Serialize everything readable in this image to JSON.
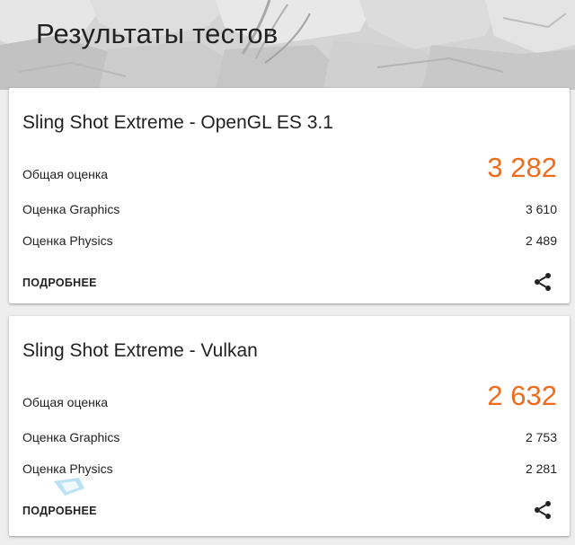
{
  "header": {
    "title": "Результаты тестов"
  },
  "cards": [
    {
      "title": "Sling Shot Extreme - OpenGL ES 3.1",
      "overall_label": "Общая оценка",
      "overall_value": "3 282",
      "graphics_label": "Оценка Graphics",
      "graphics_value": "3 610",
      "physics_label": "Оценка Physics",
      "physics_value": "2 489",
      "more_label": "ПОДРОБНЕЕ",
      "share_icon": "share-icon"
    },
    {
      "title": "Sling Shot Extreme - Vulkan",
      "overall_label": "Общая оценка",
      "overall_value": "2 632",
      "graphics_label": "Оценка Graphics",
      "graphics_value": "2 753",
      "physics_label": "Оценка Physics",
      "physics_value": "2 281",
      "more_label": "ПОДРОБНЕЕ",
      "share_icon": "share-icon"
    }
  ],
  "colors": {
    "accent": "#ef6c1c",
    "text": "#222222",
    "card_bg": "#ffffff",
    "page_bg": "#eeeeee"
  }
}
